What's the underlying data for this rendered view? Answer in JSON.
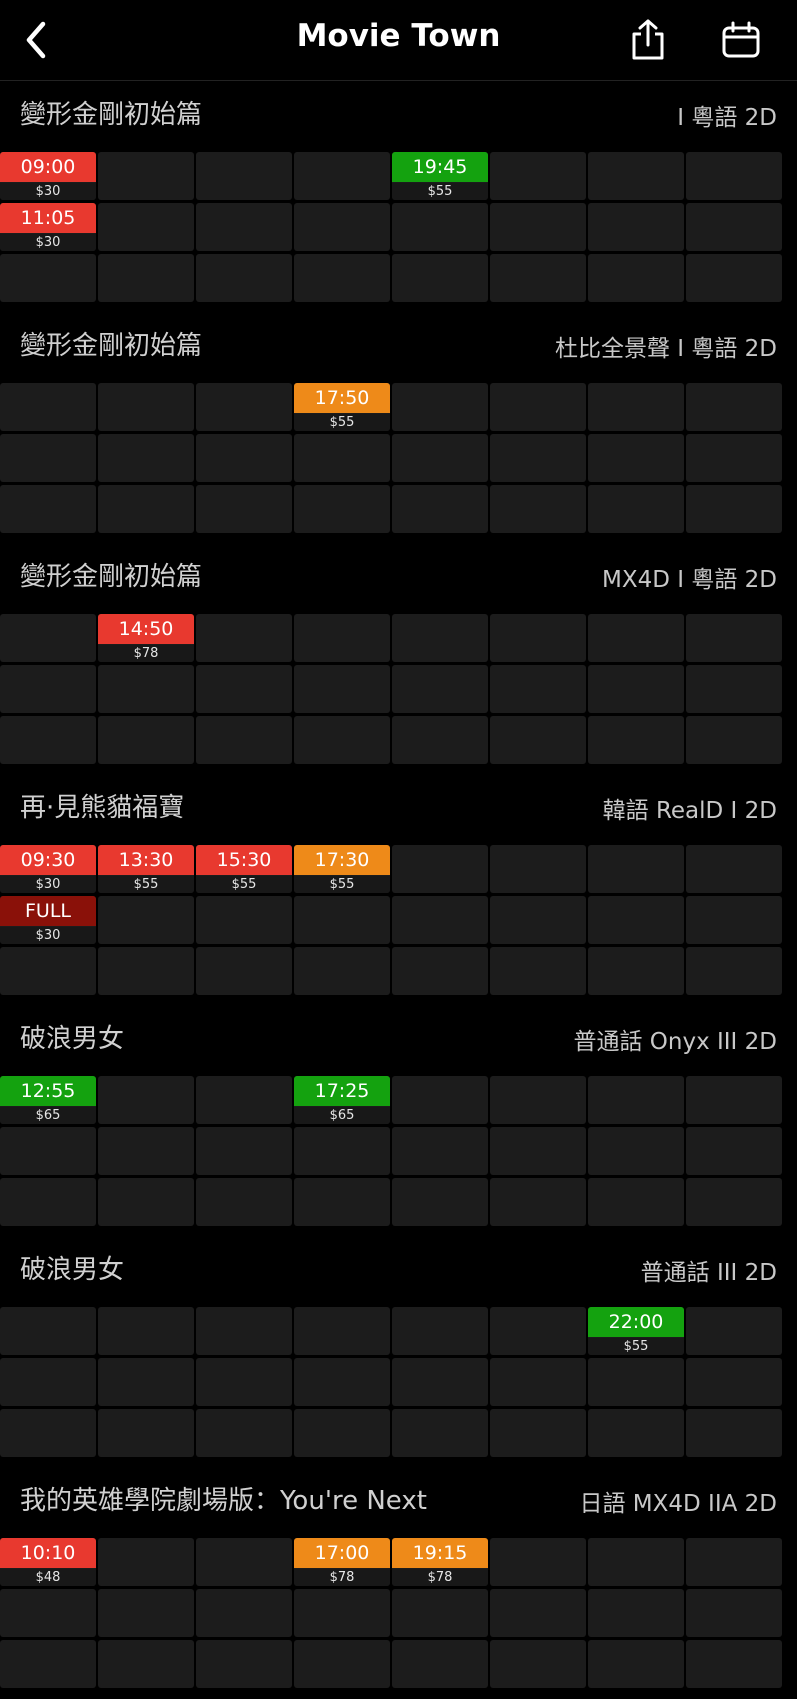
{
  "header": {
    "title": "Movie Town",
    "back_icon": "chevron-left-icon",
    "share_icon": "share-icon",
    "calendar_icon": "calendar-icon"
  },
  "colors": {
    "red": "#e8392f",
    "orange": "#ee8a19",
    "green": "#14a20f",
    "dark_red": "#8a1109",
    "empty_cell": "#1c1c1c",
    "background": "#000000"
  },
  "sections": [
    {
      "title": "變形金剛初始篇",
      "format": "I 粵語 2D",
      "showtimes": [
        {
          "row": 0,
          "col": 0,
          "time": "09:00",
          "price": "$30",
          "color": "red"
        },
        {
          "row": 0,
          "col": 4,
          "time": "19:45",
          "price": "$55",
          "color": "green"
        },
        {
          "row": 1,
          "col": 0,
          "time": "11:05",
          "price": "$30",
          "color": "red"
        }
      ]
    },
    {
      "title": "變形金剛初始篇",
      "format": "杜比全景聲 I 粵語 2D",
      "showtimes": [
        {
          "row": 0,
          "col": 3,
          "time": "17:50",
          "price": "$55",
          "color": "orange"
        }
      ]
    },
    {
      "title": "變形金剛初始篇",
      "format": "MX4D I 粵語 2D",
      "showtimes": [
        {
          "row": 0,
          "col": 1,
          "time": "14:50",
          "price": "$78",
          "color": "red"
        }
      ]
    },
    {
      "title": "再·見熊貓福寶",
      "format": "韓語 RealD I 2D",
      "showtimes": [
        {
          "row": 0,
          "col": 0,
          "time": "09:30",
          "price": "$30",
          "color": "red"
        },
        {
          "row": 0,
          "col": 1,
          "time": "13:30",
          "price": "$55",
          "color": "red"
        },
        {
          "row": 0,
          "col": 2,
          "time": "15:30",
          "price": "$55",
          "color": "red"
        },
        {
          "row": 0,
          "col": 3,
          "time": "17:30",
          "price": "$55",
          "color": "orange"
        },
        {
          "row": 1,
          "col": 0,
          "time": "FULL",
          "price": "$30",
          "color": "dark_red"
        }
      ]
    },
    {
      "title": "破浪男女",
      "format": "普通話 Onyx III 2D",
      "showtimes": [
        {
          "row": 0,
          "col": 0,
          "time": "12:55",
          "price": "$65",
          "color": "green"
        },
        {
          "row": 0,
          "col": 3,
          "time": "17:25",
          "price": "$65",
          "color": "green"
        }
      ]
    },
    {
      "title": "破浪男女",
      "format": "普通話 III 2D",
      "showtimes": [
        {
          "row": 0,
          "col": 6,
          "time": "22:00",
          "price": "$55",
          "color": "green"
        }
      ]
    },
    {
      "title": "我的英雄學院劇場版：You're Next",
      "format": "日語 MX4D IIA 2D",
      "showtimes": [
        {
          "row": 0,
          "col": 0,
          "time": "10:10",
          "price": "$48",
          "color": "red"
        },
        {
          "row": 0,
          "col": 3,
          "time": "17:00",
          "price": "$78",
          "color": "orange"
        },
        {
          "row": 0,
          "col": 4,
          "time": "19:15",
          "price": "$78",
          "color": "orange"
        }
      ]
    }
  ]
}
